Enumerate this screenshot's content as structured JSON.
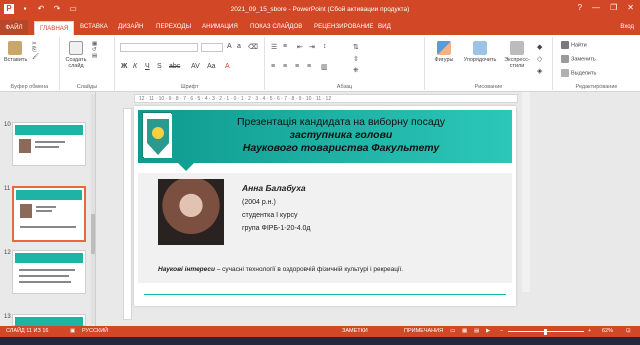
{
  "titlebar": {
    "title": "2021_09_15_sbore - PowerPoint (Сбой активации продукта)",
    "help": "?",
    "minimize": "—",
    "restore": "❐",
    "close": "✕"
  },
  "tabs": {
    "file": "ФАЙЛ",
    "home": "ГЛАВНАЯ",
    "insert": "ВСТАВКА",
    "design": "ДИЗАЙН",
    "transitions": "ПЕРЕХОДЫ",
    "animations": "АНИМАЦИЯ",
    "slideshow": "ПОКАЗ СЛАЙДОВ",
    "review": "РЕЦЕНЗИРОВАНИЕ",
    "view": "ВИД",
    "account": "Вход"
  },
  "ribbon": {
    "paste": "Вставить",
    "clipboard": "Буфер обмена",
    "new_slide": "Создать слайд",
    "slides": "Слайды",
    "font": "Шрифт",
    "font_name": "",
    "font_size": "",
    "paragraph": "Абзац",
    "shapes": "Фигуры",
    "arrange": "Упорядочить",
    "quick_styles": "Экспресс-стили",
    "drawing": "Рисование",
    "find": "Найти",
    "replace": "Заменить",
    "select": "Выделить",
    "editing": "Редактирование"
  },
  "thumbnails": [
    {
      "num": "10"
    },
    {
      "num": "11"
    },
    {
      "num": "12"
    },
    {
      "num": "13"
    }
  ],
  "ruler_numbers": "12 · 11 · 10 · 9 · 8 · 7 · 6 · 5 · 4 · 3 · 2 · 1 · 0 · 1 · 2 · 3 · 4 · 5 · 6 · 7 · 8 · 9 · 10 · 11 · 12",
  "slide": {
    "title_line1": "Презентація кандидата на виборну посаду",
    "title_line2": "заступника голови",
    "title_line3": "Наукового товариства Факультету",
    "name": "Анна Балабуха",
    "year": "(2004 р.н.)",
    "course": "студентка І курсу",
    "group": "група ФІРБ-1-20-4.0д",
    "interests_label": "Наукові інтереси",
    "interests_text": " – сучасні технології в оздоровчій фізичній культурі і рекреації."
  },
  "status": {
    "slide": "СЛАЙД 11 ИЗ 16",
    "lang": "РУССКИЙ",
    "notes": "ЗАМЕТКИ",
    "comments": "ПРИМЕЧАНИЯ",
    "zoom": "62%"
  },
  "colors": {
    "accent": "#d24726",
    "teal": "#1fb3a6"
  }
}
